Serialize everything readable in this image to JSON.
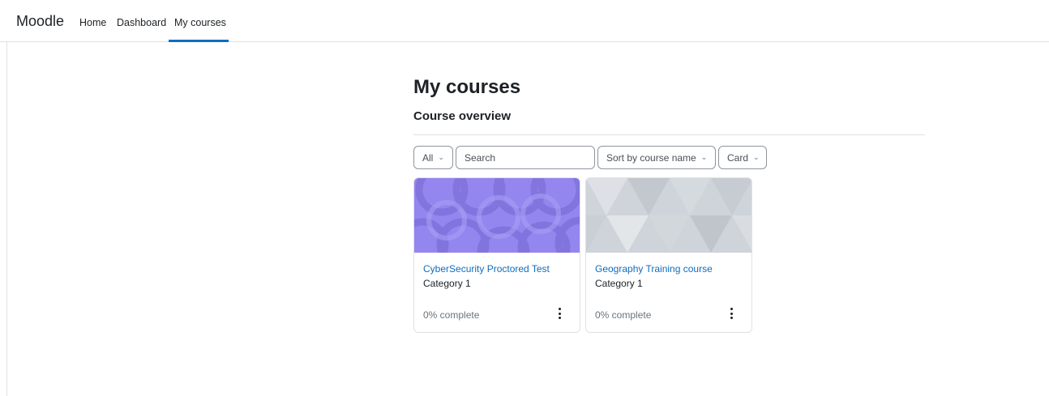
{
  "navbar": {
    "brand": "Moodle",
    "links": [
      {
        "label": "Home"
      },
      {
        "label": "Dashboard"
      },
      {
        "label": "My courses"
      }
    ],
    "active": "My courses"
  },
  "page": {
    "title": "My courses",
    "section_title": "Course overview"
  },
  "controls": {
    "filter_label": "All",
    "search_placeholder": "Search",
    "sort_label": "Sort by course name",
    "view_label": "Card"
  },
  "courses": [
    {
      "name": "CyberSecurity Proctored Test",
      "category": "Category 1",
      "progress": "0% complete",
      "image_color": "#9386ef"
    },
    {
      "name": "Geography Training course",
      "category": "Category 1",
      "progress": "0% complete",
      "image_color": "#ced4da"
    }
  ],
  "colors": {
    "link": "#0f6cbf",
    "active_underline": "#0f6cbf",
    "border": "#dee2e6"
  }
}
